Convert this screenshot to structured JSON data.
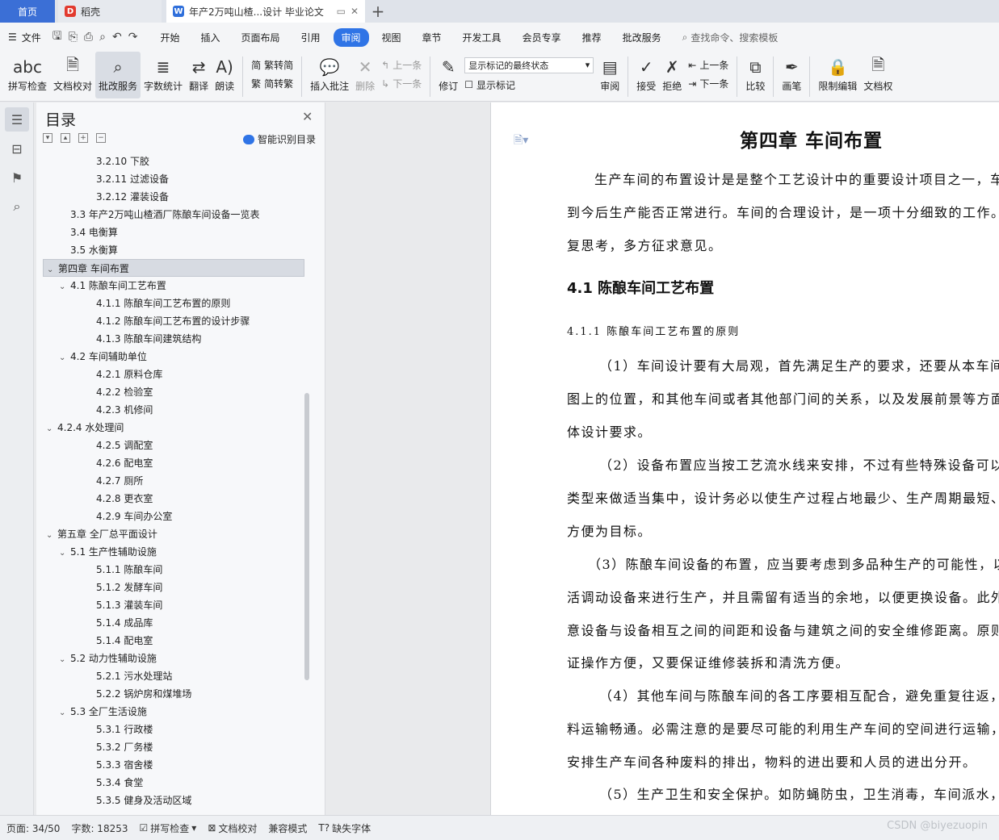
{
  "tabs": {
    "home": "首页",
    "daoke": "稻壳",
    "doc": "年产2万吨山楂...设计 毕业论文"
  },
  "menu": {
    "file": "文件",
    "items": [
      "开始",
      "插入",
      "页面布局",
      "引用",
      "审阅",
      "视图",
      "章节",
      "开发工具",
      "会员专享",
      "推荐",
      "批改服务"
    ],
    "search": "查找命令、搜索模板"
  },
  "ribbon": {
    "spell_check": "拼写检查",
    "doc_proof": "文档校对",
    "grading": "批改服务",
    "word_count": "字数统计",
    "translate": "翻译",
    "read_aloud": "朗读",
    "trad_to_simp": "繁转简",
    "simp_to_trad": "简转繁",
    "insert_comment": "插入批注",
    "delete": "删除",
    "prev_comment": "上一条",
    "next_comment": "下一条",
    "revise": "修订",
    "markup_select": "显示标记的最终状态",
    "show_markup": "显示标记",
    "review": "审阅",
    "accept": "接受",
    "reject": "拒绝",
    "prev_change": "上一条",
    "next_change": "下一条",
    "compare": "比较",
    "pen": "画笔",
    "restrict": "限制编辑",
    "doc_perm": "文档权"
  },
  "toc": {
    "title": "目录",
    "smart": "智能识别目录",
    "items": [
      {
        "text": "3.2.10 下胶",
        "level": 3,
        "caret": ""
      },
      {
        "text": "3.2.11 过滤设备",
        "level": 3,
        "caret": ""
      },
      {
        "text": "3.2.12 灌装设备",
        "level": 3,
        "caret": ""
      },
      {
        "text": "3.3 年产2万吨山楂酒厂陈酿车间设备一览表",
        "level": 2,
        "caret": ""
      },
      {
        "text": "3.4 电衡算",
        "level": 2,
        "caret": ""
      },
      {
        "text": "3.5 水衡算",
        "level": 2,
        "caret": ""
      },
      {
        "text": "第四章  车间布置",
        "level": 1,
        "caret": "v",
        "selected": true
      },
      {
        "text": "4.1 陈酿车间工艺布置",
        "level": 2,
        "caret": "v"
      },
      {
        "text": "4.1.1 陈酿车间工艺布置的原则",
        "level": 3,
        "caret": ""
      },
      {
        "text": "4.1.2 陈酿车间工艺布置的设计步骤",
        "level": 3,
        "caret": ""
      },
      {
        "text": "4.1.3 陈酿车间建筑结构",
        "level": 3,
        "caret": ""
      },
      {
        "text": "4.2  车间辅助单位",
        "level": 2,
        "caret": "v"
      },
      {
        "text": "4.2.1 原料仓库",
        "level": 3,
        "caret": ""
      },
      {
        "text": "4.2.2 检验室",
        "level": 3,
        "caret": ""
      },
      {
        "text": "4.2.3  机修间",
        "level": 3,
        "caret": ""
      },
      {
        "text": "4.2.4 水处理间",
        "level": 1,
        "caret": "v"
      },
      {
        "text": "4.2.5 调配室",
        "level": 3,
        "caret": ""
      },
      {
        "text": "4.2.6 配电室",
        "level": 3,
        "caret": ""
      },
      {
        "text": "4.2.7 厕所",
        "level": 3,
        "caret": ""
      },
      {
        "text": "4.2.8 更衣室",
        "level": 3,
        "caret": ""
      },
      {
        "text": "4.2.9 车间办公室",
        "level": 3,
        "caret": ""
      },
      {
        "text": "第五章  全厂总平面设计",
        "level": 1,
        "caret": "v"
      },
      {
        "text": "5.1 生产性辅助设施",
        "level": 2,
        "caret": "v"
      },
      {
        "text": "5.1.1 陈酿车间",
        "level": 3,
        "caret": ""
      },
      {
        "text": "5.1.2 发酵车间",
        "level": 3,
        "caret": ""
      },
      {
        "text": "5.1.3 灌装车间",
        "level": 3,
        "caret": ""
      },
      {
        "text": "5.1.4 成品库",
        "level": 3,
        "caret": ""
      },
      {
        "text": "5.1.4 配电室",
        "level": 3,
        "caret": ""
      },
      {
        "text": "5.2 动力性辅助设施",
        "level": 2,
        "caret": "v"
      },
      {
        "text": "5.2.1 污水处理站",
        "level": 3,
        "caret": ""
      },
      {
        "text": "5.2.2 锅炉房和煤堆场",
        "level": 3,
        "caret": ""
      },
      {
        "text": "5.3 全厂生活设施",
        "level": 2,
        "caret": "v"
      },
      {
        "text": "5.3.1 行政楼",
        "level": 3,
        "caret": ""
      },
      {
        "text": "5.3.2 厂务楼",
        "level": 3,
        "caret": ""
      },
      {
        "text": "5.3.3 宿舍楼",
        "level": 3,
        "caret": ""
      },
      {
        "text": "5.3.4 食堂",
        "level": 3,
        "caret": ""
      },
      {
        "text": "5.3.5 健身及活动区域",
        "level": 3,
        "caret": ""
      }
    ]
  },
  "document": {
    "chapter": "第四章  车间布置",
    "h2": "4.1 陈酿车间工艺布置",
    "h3": "4.1.1 陈酿车间工艺布置的原则",
    "lines": [
      "生产车间的布置设计是是整个工艺设计中的重要设计项目之一，车",
      "到今后生产能否正常进行。车间的合理设计，是一项十分细致的工作。",
      "复思考，多方征求意见。",
      "（1）车间设计要有大局观，首先满足生产的要求，还要从本车间",
      "图上的位置，和其他车间或者其他部门间的关系，以及发展前景等方面",
      "体设计要求。",
      "（2）设备布置应当按工艺流水线来安排，不过有些特殊设备可以",
      "类型来做适当集中，设计务必以使生产过程占地最少、生产周期最短、",
      "方便为目标。",
      "（3）陈酿车间设备的布置，应当要考虑到多品种生产的可能性，以",
      "活调动设备来进行生产，并且需留有适当的余地，以便更换设备。此外",
      "意设备与设备相互之间的间距和设备与建筑之间的安全维修距离。原则",
      "证操作方便，又要保证维修装拆和清洗方便。",
      "（4）其他车间与陈酿车间的各工序要相互配合，避免重复往返，",
      "料运输畅通。必需注意的是要尽可能的利用生产车间的空间进行运输，",
      "安排生产车间各种废料的排出，物料的进出要和人员的进出分开。",
      "（5）生产卫生和安全保护。如防蝇防虫，卫生消毒，车间派水，"
    ]
  },
  "status": {
    "page": "页面: 34/50",
    "words": "字数: 18253",
    "spell": "拼写检查",
    "proof": "文档校对",
    "compat": "兼容模式",
    "missing_font": "缺失字体"
  },
  "watermark": "CSDN @biyezuopin",
  "colors": {
    "accent": "#2f74e6",
    "home_tab": "#3b6fd6"
  }
}
